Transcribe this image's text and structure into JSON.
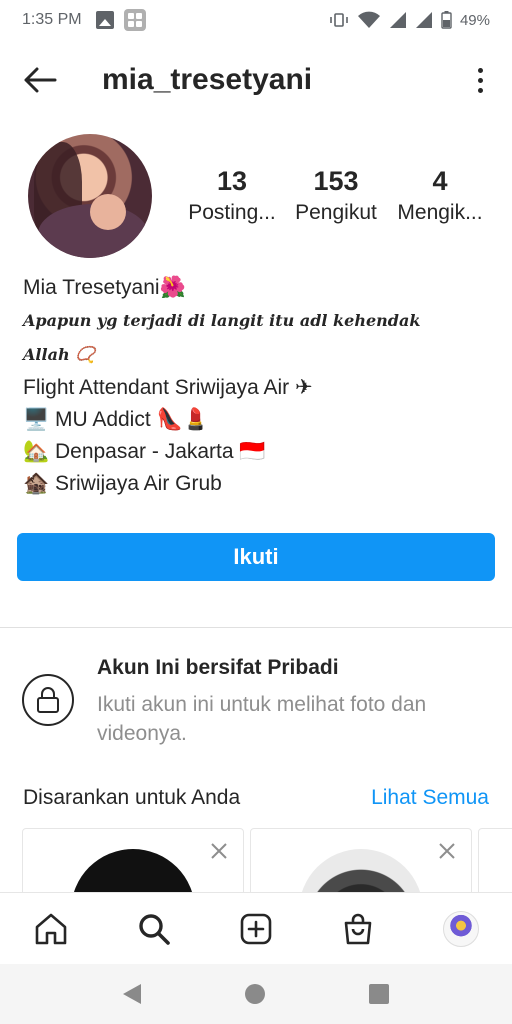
{
  "status_bar": {
    "time": "1:35 PM",
    "battery": "49%"
  },
  "header": {
    "username": "mia_tresetyani"
  },
  "stats": [
    {
      "value": "13",
      "label": "Posting..."
    },
    {
      "value": "153",
      "label": "Pengikut"
    },
    {
      "value": "4",
      "label": "Mengik..."
    }
  ],
  "bio": {
    "name": "Mia Tresetyani🌺",
    "quote_line1": "Apapun yg terjadi di langit itu adl kehendak",
    "quote_line2": "Allah 📿",
    "line3": "Flight Attendant Sriwijaya Air ✈",
    "line4": "🖥️ MU Addict 👠💄",
    "line5": "🏡 Denpasar - Jakarta 🇮🇩",
    "line6": "🏚️ Sriwijaya Air Grub"
  },
  "follow_button": "Ikuti",
  "private_notice": {
    "title": "Akun Ini bersifat Pribadi",
    "description": "Ikuti akun ini untuk melihat foto dan videonya."
  },
  "suggestions": {
    "title": "Disarankan untuk Anda",
    "see_all": "Lihat Semua"
  },
  "icons": {
    "back": "arrow-left-icon",
    "more": "more-vertical-icon",
    "lock": "lock-icon",
    "home": "home-icon",
    "search": "search-icon",
    "new_post": "plus-square-icon",
    "shop": "shopping-bag-icon"
  },
  "colors": {
    "accent": "#1095f6",
    "text": "#262626",
    "muted": "#8e8e8e"
  }
}
